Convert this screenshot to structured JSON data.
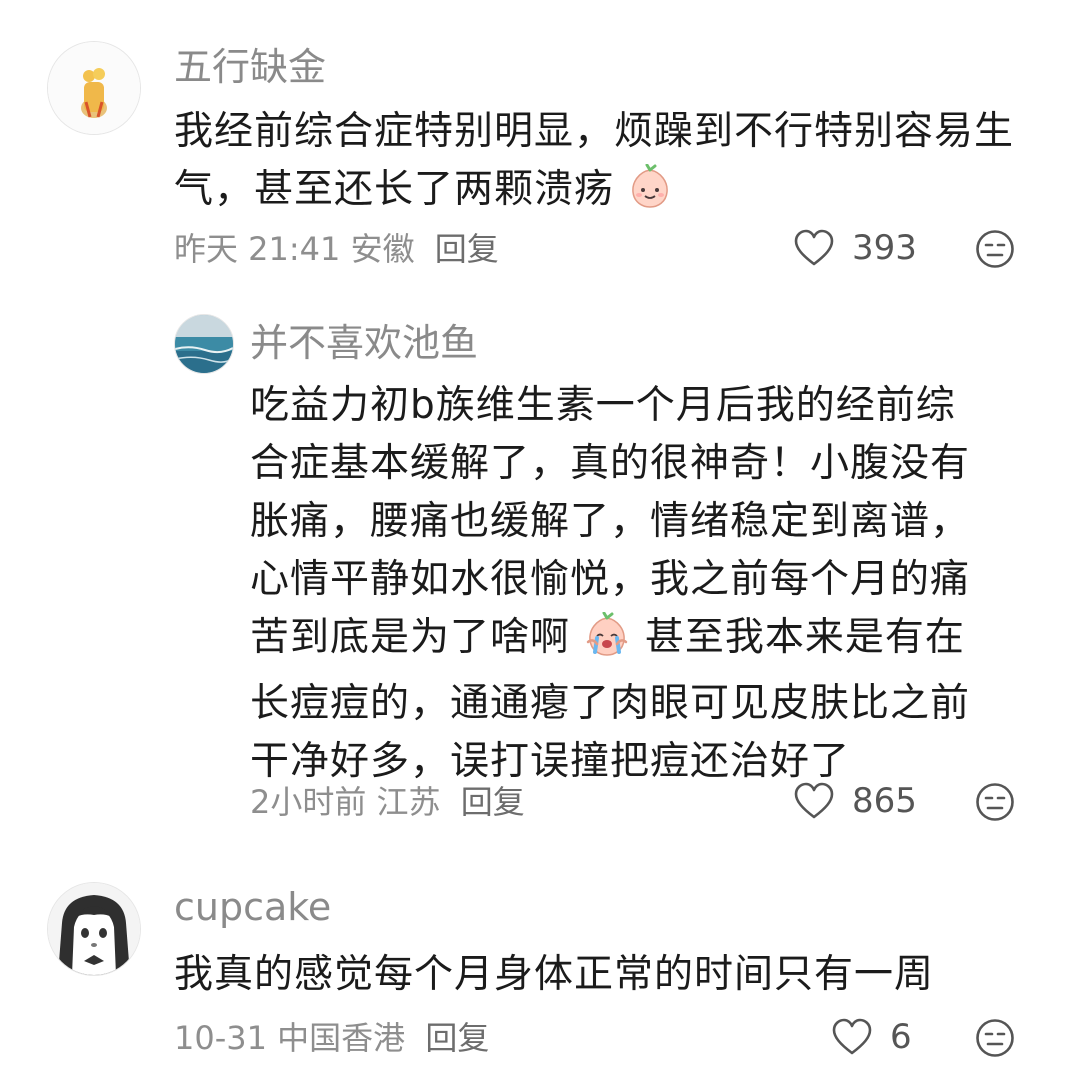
{
  "comments": [
    {
      "username": "五行缺金",
      "text": "我经前综合症特别明显，烦躁到不行特别容易生气，甚至还长了两颗溃疡",
      "time": "昨天 21:41",
      "location": "安徽",
      "reply_label": "回复",
      "likes": "393",
      "avatar_icon": "fries-avatar-icon",
      "emoji": "peach-smile-emoji"
    },
    {
      "username": "并不喜欢池鱼",
      "text_lines": [
        "吃益力初b族维生素一个月后我的经前综",
        "合症基本缓解了，真的很神奇！小腹没有",
        "胀痛，腰痛也缓解了，情绪稳定到离谱，",
        "心情平静如水很愉悦，我之前每个月的痛",
        "苦到底是为了啥啊",
        " 甚至我本来是有在",
        "长痘痘的，通通瘪了肉眼可见皮肤比之前",
        "干净好多，误打误撞把痘还治好了"
      ],
      "time": "2小时前",
      "location": "江苏",
      "reply_label": "回复",
      "likes": "865",
      "avatar_icon": "seascape-avatar-icon",
      "emoji": "peach-crying-emoji"
    },
    {
      "username": "cupcake",
      "text": "我真的感觉每个月身体正常的时间只有一周",
      "time": "10-31",
      "location": "中国香港",
      "reply_label": "回复",
      "likes": "6",
      "avatar_icon": "anime-girl-avatar-icon"
    }
  ],
  "colors": {
    "username": "#8a8a8a",
    "text": "#1b1b1b",
    "meta": "#8e8e8e",
    "icon": "#555555"
  }
}
